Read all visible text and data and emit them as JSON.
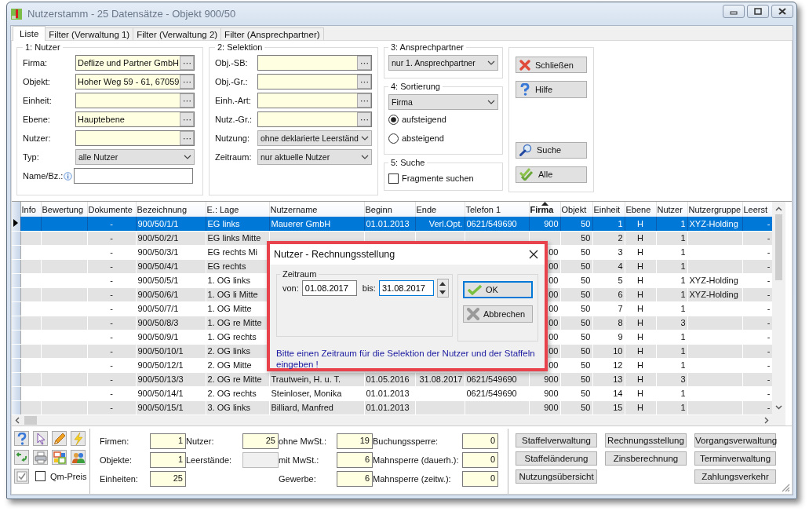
{
  "window": {
    "title": "Nutzerstamm - 25 Datensätze - Objekt 900/50"
  },
  "tabs": [
    {
      "label": "Liste",
      "selected": true
    },
    {
      "label": "Filter (Verwaltung 1)",
      "selected": false
    },
    {
      "label": "Filter (Verwaltung 2)",
      "selected": false
    },
    {
      "label": "Filter (Ansprechpartner)",
      "selected": false
    }
  ],
  "group_nutzer": {
    "title": "1: Nutzer",
    "fields": [
      {
        "label": "Firma:",
        "kind": "lookup",
        "value": "Deflize und Partner GmbH"
      },
      {
        "label": "Objekt:",
        "kind": "lookup",
        "value": "Hoher Weg 59 - 61, 67059"
      },
      {
        "label": "Einheit:",
        "kind": "lookup"
      },
      {
        "label": "Ebene:",
        "kind": "lookup",
        "value": "Hauptebene"
      },
      {
        "label": "Nutzer:",
        "kind": "lookup"
      },
      {
        "label": "Typ:",
        "kind": "select",
        "value": "alle Nutzer"
      },
      {
        "label": "Name/Bz.:",
        "kind": "text"
      }
    ]
  },
  "group_selektion": {
    "title": "2: Selektion",
    "fields": [
      {
        "label": "Obj.-SB:",
        "kind": "lookup"
      },
      {
        "label": "Obj.-Gr.:",
        "kind": "lookup"
      },
      {
        "label": "Einh.-Art:",
        "kind": "lookup"
      },
      {
        "label": "Nutz.-Gr.:",
        "kind": "lookup"
      },
      {
        "label": "Nutzung:",
        "kind": "select",
        "value": "ohne deklarierte Leerständ"
      },
      {
        "label": "Zeitraum:",
        "kind": "select",
        "value": "nur aktuelle Nutzer"
      }
    ]
  },
  "group_ansprechpartner": {
    "title": "3: Ansprechpartner",
    "value": "nur 1. Ansprechpartner"
  },
  "group_sortierung": {
    "title": "4: Sortierung",
    "value": "Firma",
    "options": [
      {
        "label": "aufsteigend",
        "selected": true
      },
      {
        "label": "absteigend",
        "selected": false
      }
    ]
  },
  "group_suche": {
    "title": "5: Suche",
    "checkbox": {
      "label": "Fragmente suchen",
      "checked": false
    }
  },
  "actions": [
    {
      "label": "Schließen",
      "kind": "close"
    },
    {
      "label": "Hilfe",
      "kind": "help"
    },
    {
      "label": "Suche",
      "kind": "search"
    },
    {
      "label": "Alle",
      "kind": "all"
    }
  ],
  "table": {
    "columns": [
      {
        "label": "Info",
        "sorted": false
      },
      {
        "label": "Bewertung",
        "sorted": false
      },
      {
        "label": "Dokumente",
        "sorted": false
      },
      {
        "label": "Bezeichnung",
        "sorted": false
      },
      {
        "label": "E.: Lage",
        "sorted": false
      },
      {
        "label": "Nutzername",
        "sorted": false
      },
      {
        "label": "Beginn",
        "sorted": false
      },
      {
        "label": "Ende",
        "sorted": false
      },
      {
        "label": "Telefon 1",
        "sorted": false
      },
      {
        "label": "Firma",
        "sorted": true
      },
      {
        "label": "Objekt",
        "sorted": false
      },
      {
        "label": "Einheit",
        "sorted": false
      },
      {
        "label": "Ebene",
        "sorted": false
      },
      {
        "label": "Nutzer",
        "sorted": false
      },
      {
        "label": "Nutzergruppe",
        "sorted": false
      },
      {
        "label": "Leerst",
        "sorted": false
      }
    ],
    "rows": [
      {
        "selected": true,
        "cells": [
          null,
          null,
          "-",
          "900/50/1/1",
          "EG links",
          "Mauerer GmbH",
          "01.01.2013",
          "Verl.Opt.",
          "0621/549690",
          "900",
          "50",
          "1",
          "H",
          "1",
          "XYZ-Holding",
          "-"
        ]
      },
      {
        "selected": false,
        "cells": [
          null,
          null,
          "-",
          "900/50/2/1",
          "EG links Mitte",
          null,
          null,
          null,
          null,
          null,
          "50",
          "2",
          "H",
          "1",
          null,
          "-"
        ]
      },
      {
        "selected": false,
        "cells": [
          null,
          null,
          "-",
          "900/50/3/1",
          "EG rechts Mi",
          null,
          null,
          null,
          null,
          "00",
          "50",
          "3",
          "H",
          "1",
          null,
          "-"
        ]
      },
      {
        "selected": false,
        "cells": [
          null,
          null,
          "-",
          "900/50/4/1",
          "EG rechts",
          null,
          null,
          null,
          null,
          "00",
          "50",
          "4",
          "H",
          "1",
          null,
          "-"
        ]
      },
      {
        "selected": false,
        "cells": [
          null,
          null,
          "-",
          "900/50/5/1",
          "1. OG links",
          null,
          null,
          null,
          null,
          "00",
          "50",
          "5",
          "H",
          "1",
          "XYZ-Holding",
          "-"
        ]
      },
      {
        "selected": false,
        "cells": [
          null,
          null,
          "-",
          "900/50/6/1",
          "1. OG li Mitte",
          null,
          null,
          null,
          null,
          "00",
          "50",
          "6",
          "H",
          "1",
          "XYZ-Holding",
          "-"
        ]
      },
      {
        "selected": false,
        "cells": [
          null,
          null,
          "-",
          "900/50/7/1",
          "1. OG Mitte",
          null,
          null,
          null,
          null,
          "00",
          "50",
          "7",
          "H",
          "1",
          null,
          "-"
        ]
      },
      {
        "selected": false,
        "cells": [
          null,
          null,
          "-",
          "900/50/8/3",
          "1. OG re Mitte",
          null,
          null,
          null,
          null,
          "00",
          "50",
          "8",
          "H",
          "3",
          null,
          "-"
        ]
      },
      {
        "selected": false,
        "cells": [
          null,
          null,
          "-",
          "900/50/9/1",
          "1. OG rechts",
          null,
          null,
          null,
          null,
          "00",
          "50",
          "9",
          "H",
          "1",
          null,
          "-"
        ]
      },
      {
        "selected": false,
        "cells": [
          null,
          null,
          "-",
          "900/50/10/1",
          "2. OG links",
          null,
          null,
          null,
          null,
          "00",
          "50",
          "10",
          "H",
          "1",
          null,
          "-"
        ]
      },
      {
        "selected": false,
        "cells": [
          null,
          null,
          "-",
          "900/50/12/1",
          "2. OG Mitte",
          null,
          null,
          null,
          null,
          "00",
          "50",
          "12",
          "H",
          "1",
          null,
          "-"
        ]
      },
      {
        "selected": false,
        "cells": [
          null,
          null,
          "-",
          "900/50/13/3",
          "2. OG re Mitte",
          "Trautwein, H. u. T.",
          "01.05.2016",
          "31.08.2017",
          "0621/549690",
          "900",
          "50",
          "13",
          "H",
          "3",
          null,
          "-"
        ]
      },
      {
        "selected": false,
        "cells": [
          null,
          null,
          "-",
          "900/50/14/1",
          "2. OG rechts",
          "Steinloser, Monika",
          "01.01.2013",
          null,
          "0621/549690",
          "900",
          "50",
          "14",
          "H",
          "1",
          null,
          "-"
        ]
      },
      {
        "selected": false,
        "cells": [
          null,
          null,
          "-",
          "900/50/15/1",
          "3. OG links",
          "Billiard, Manfred",
          "01.01.2013",
          null,
          null,
          "900",
          "50",
          "15",
          "H",
          "1",
          null,
          "-"
        ]
      }
    ]
  },
  "dialog": {
    "title": "Nutzer - Rechnungsstellung",
    "group": "Zeitraum",
    "fields": [
      {
        "label": "von:",
        "value": "01.08.2017",
        "focused": false
      },
      {
        "label": "bis:",
        "value": "31.08.2017",
        "focused": true
      }
    ],
    "buttons": [
      {
        "label": "OK",
        "kind": "ok",
        "default": true
      },
      {
        "label": "Abbrechen",
        "kind": "cancel",
        "default": false
      }
    ],
    "message": "Bitte einen Zeitraum für die Selektion der Nutzer und der Staffeln eingeben !"
  },
  "bottom": {
    "qm_preis": {
      "label": "Qm-Preis",
      "checked": false
    },
    "counter_columns": [
      {
        "items": [
          {
            "label": "Firmen:",
            "value": "1",
            "disabled": false
          },
          {
            "label": "Objekte:",
            "value": "1",
            "disabled": false
          },
          {
            "label": "Einheiten:",
            "value": "25",
            "disabled": false
          }
        ]
      },
      {
        "items": [
          {
            "label": "Nutzer:",
            "value": "25",
            "disabled": false
          },
          {
            "label": "Leerstände:",
            "disabled": true
          }
        ]
      },
      {
        "items": [
          {
            "label": "ohne MwSt.:",
            "value": "19",
            "disabled": false
          },
          {
            "label": "mit MwSt.:",
            "value": "6",
            "disabled": false
          },
          {
            "label": "Gewerbe:",
            "value": "6",
            "disabled": false
          }
        ]
      },
      {
        "items": [
          {
            "label": "Buchungssperre:",
            "value": "0",
            "disabled": false
          },
          {
            "label": "Mahnsperre (dauerh.):",
            "value": "0",
            "disabled": false
          },
          {
            "label": "Mahnsperre (zeitw.):",
            "value": "0",
            "disabled": false
          }
        ]
      }
    ],
    "button_columns": [
      {
        "buttons": [
          "Staffelverwaltung",
          "Staffeländerung",
          "Nutzungsübersicht"
        ]
      },
      {
        "buttons": [
          "Rechnungsstellung",
          "Zinsberechnung"
        ]
      },
      {
        "buttons": [
          "Vorgangsverwaltung",
          "Terminverwaltung",
          "Zahlungsverkehr"
        ]
      }
    ]
  }
}
